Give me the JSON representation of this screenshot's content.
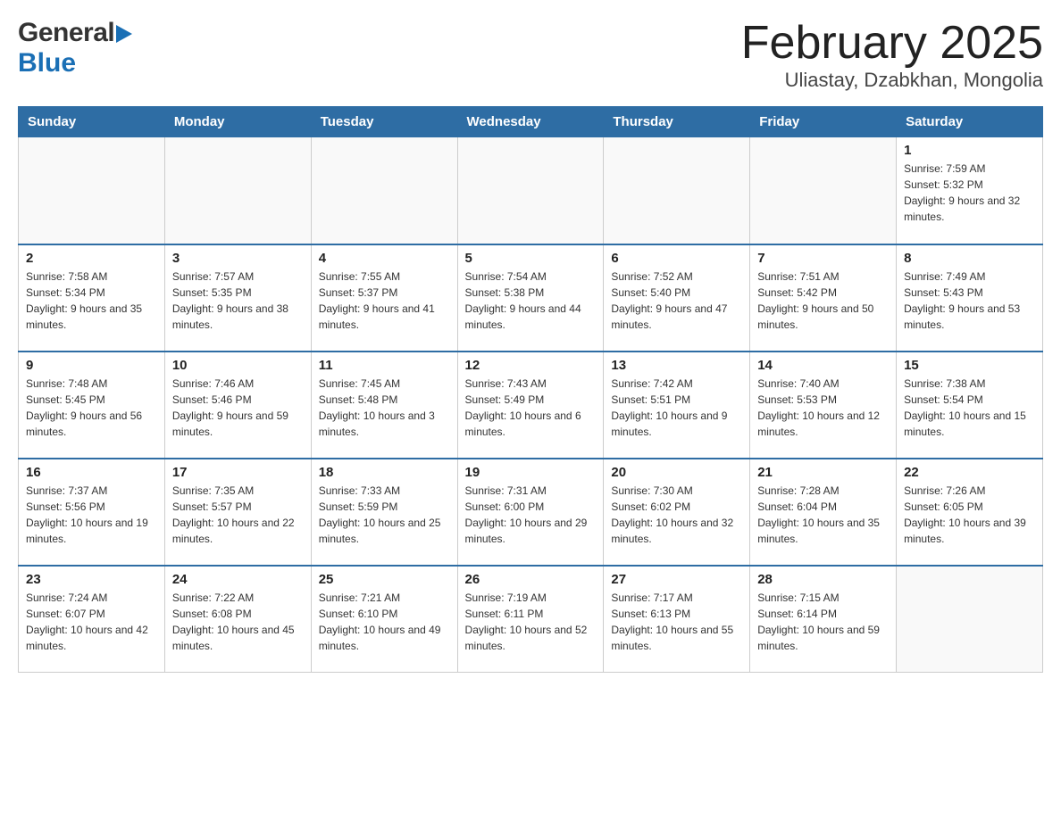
{
  "header": {
    "logo_general": "General",
    "logo_blue": "Blue",
    "title": "February 2025",
    "subtitle": "Uliastay, Dzabkhan, Mongolia"
  },
  "weekdays": [
    "Sunday",
    "Monday",
    "Tuesday",
    "Wednesday",
    "Thursday",
    "Friday",
    "Saturday"
  ],
  "weeks": [
    [
      {
        "day": "",
        "info": ""
      },
      {
        "day": "",
        "info": ""
      },
      {
        "day": "",
        "info": ""
      },
      {
        "day": "",
        "info": ""
      },
      {
        "day": "",
        "info": ""
      },
      {
        "day": "",
        "info": ""
      },
      {
        "day": "1",
        "info": "Sunrise: 7:59 AM\nSunset: 5:32 PM\nDaylight: 9 hours and 32 minutes."
      }
    ],
    [
      {
        "day": "2",
        "info": "Sunrise: 7:58 AM\nSunset: 5:34 PM\nDaylight: 9 hours and 35 minutes."
      },
      {
        "day": "3",
        "info": "Sunrise: 7:57 AM\nSunset: 5:35 PM\nDaylight: 9 hours and 38 minutes."
      },
      {
        "day": "4",
        "info": "Sunrise: 7:55 AM\nSunset: 5:37 PM\nDaylight: 9 hours and 41 minutes."
      },
      {
        "day": "5",
        "info": "Sunrise: 7:54 AM\nSunset: 5:38 PM\nDaylight: 9 hours and 44 minutes."
      },
      {
        "day": "6",
        "info": "Sunrise: 7:52 AM\nSunset: 5:40 PM\nDaylight: 9 hours and 47 minutes."
      },
      {
        "day": "7",
        "info": "Sunrise: 7:51 AM\nSunset: 5:42 PM\nDaylight: 9 hours and 50 minutes."
      },
      {
        "day": "8",
        "info": "Sunrise: 7:49 AM\nSunset: 5:43 PM\nDaylight: 9 hours and 53 minutes."
      }
    ],
    [
      {
        "day": "9",
        "info": "Sunrise: 7:48 AM\nSunset: 5:45 PM\nDaylight: 9 hours and 56 minutes."
      },
      {
        "day": "10",
        "info": "Sunrise: 7:46 AM\nSunset: 5:46 PM\nDaylight: 9 hours and 59 minutes."
      },
      {
        "day": "11",
        "info": "Sunrise: 7:45 AM\nSunset: 5:48 PM\nDaylight: 10 hours and 3 minutes."
      },
      {
        "day": "12",
        "info": "Sunrise: 7:43 AM\nSunset: 5:49 PM\nDaylight: 10 hours and 6 minutes."
      },
      {
        "day": "13",
        "info": "Sunrise: 7:42 AM\nSunset: 5:51 PM\nDaylight: 10 hours and 9 minutes."
      },
      {
        "day": "14",
        "info": "Sunrise: 7:40 AM\nSunset: 5:53 PM\nDaylight: 10 hours and 12 minutes."
      },
      {
        "day": "15",
        "info": "Sunrise: 7:38 AM\nSunset: 5:54 PM\nDaylight: 10 hours and 15 minutes."
      }
    ],
    [
      {
        "day": "16",
        "info": "Sunrise: 7:37 AM\nSunset: 5:56 PM\nDaylight: 10 hours and 19 minutes."
      },
      {
        "day": "17",
        "info": "Sunrise: 7:35 AM\nSunset: 5:57 PM\nDaylight: 10 hours and 22 minutes."
      },
      {
        "day": "18",
        "info": "Sunrise: 7:33 AM\nSunset: 5:59 PM\nDaylight: 10 hours and 25 minutes."
      },
      {
        "day": "19",
        "info": "Sunrise: 7:31 AM\nSunset: 6:00 PM\nDaylight: 10 hours and 29 minutes."
      },
      {
        "day": "20",
        "info": "Sunrise: 7:30 AM\nSunset: 6:02 PM\nDaylight: 10 hours and 32 minutes."
      },
      {
        "day": "21",
        "info": "Sunrise: 7:28 AM\nSunset: 6:04 PM\nDaylight: 10 hours and 35 minutes."
      },
      {
        "day": "22",
        "info": "Sunrise: 7:26 AM\nSunset: 6:05 PM\nDaylight: 10 hours and 39 minutes."
      }
    ],
    [
      {
        "day": "23",
        "info": "Sunrise: 7:24 AM\nSunset: 6:07 PM\nDaylight: 10 hours and 42 minutes."
      },
      {
        "day": "24",
        "info": "Sunrise: 7:22 AM\nSunset: 6:08 PM\nDaylight: 10 hours and 45 minutes."
      },
      {
        "day": "25",
        "info": "Sunrise: 7:21 AM\nSunset: 6:10 PM\nDaylight: 10 hours and 49 minutes."
      },
      {
        "day": "26",
        "info": "Sunrise: 7:19 AM\nSunset: 6:11 PM\nDaylight: 10 hours and 52 minutes."
      },
      {
        "day": "27",
        "info": "Sunrise: 7:17 AM\nSunset: 6:13 PM\nDaylight: 10 hours and 55 minutes."
      },
      {
        "day": "28",
        "info": "Sunrise: 7:15 AM\nSunset: 6:14 PM\nDaylight: 10 hours and 59 minutes."
      },
      {
        "day": "",
        "info": ""
      }
    ]
  ]
}
